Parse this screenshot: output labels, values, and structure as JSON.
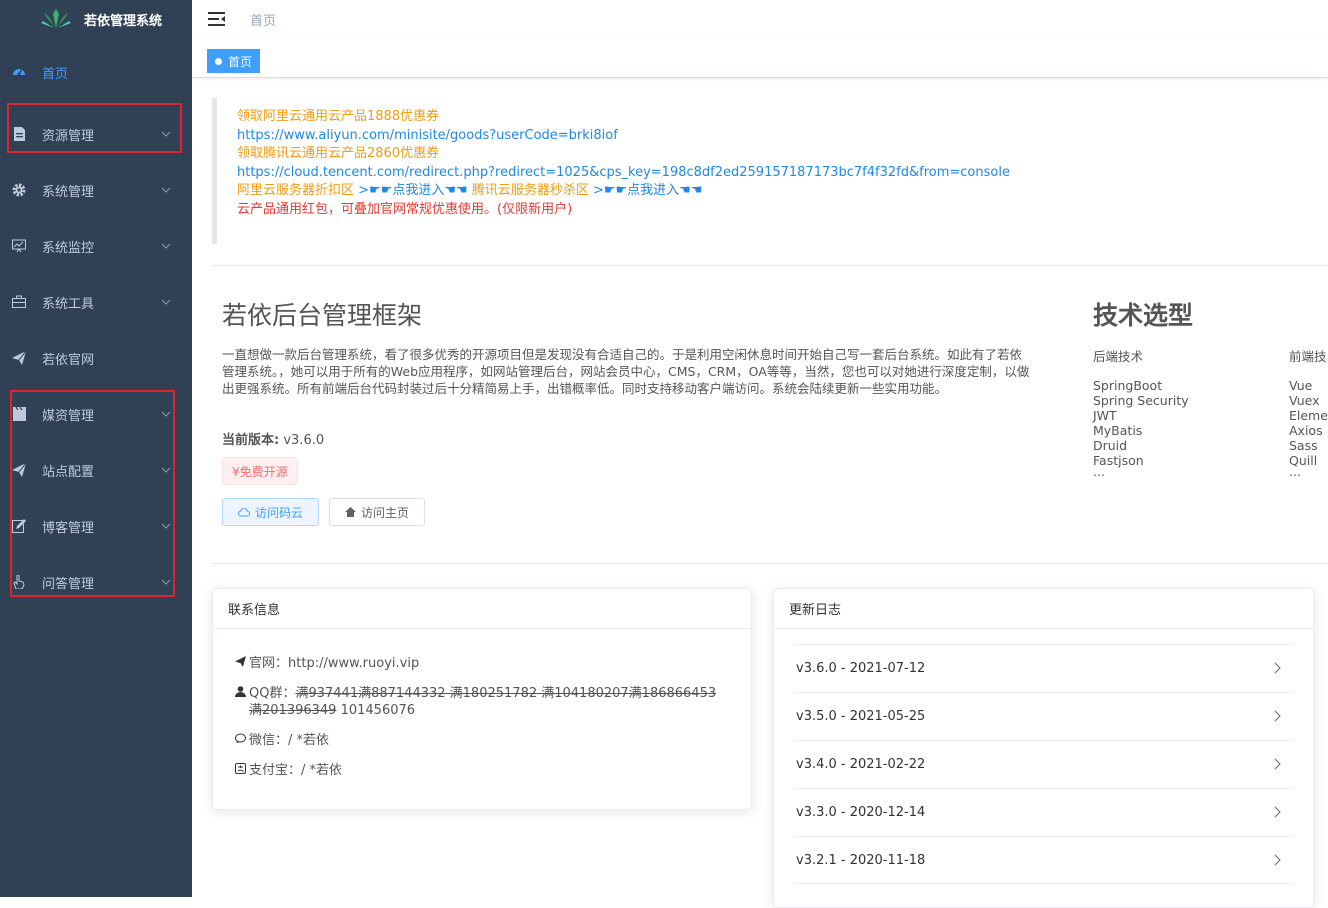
{
  "app": {
    "title": "若依管理系统"
  },
  "sidebar": {
    "items": [
      {
        "label": "首页",
        "icon": "dashboard-icon"
      },
      {
        "label": "资源管理",
        "icon": "document-icon"
      },
      {
        "label": "系统管理",
        "icon": "gear-icon"
      },
      {
        "label": "系统监控",
        "icon": "monitor-icon"
      },
      {
        "label": "系统工具",
        "icon": "toolbox-icon"
      },
      {
        "label": "若依官网",
        "icon": "paper-plane-icon"
      },
      {
        "label": "媒资管理",
        "icon": "clapper-icon"
      },
      {
        "label": "站点配置",
        "icon": "paper-plane-icon"
      },
      {
        "label": "博客管理",
        "icon": "edit-icon"
      },
      {
        "label": "问答管理",
        "icon": "hand-icon"
      }
    ]
  },
  "navbar": {
    "breadcrumb": "首页"
  },
  "tags": {
    "active": "首页"
  },
  "notice": {
    "line1": "领取阿里云通用云产品1888优惠券",
    "line2": "https://www.aliyun.com/minisite/goods?userCode=brki8iof",
    "line3": "领取腾讯云通用云产品2860优惠券",
    "line4": "https://cloud.tencent.com/redirect.php?redirect=1025&cps_key=198c8df2ed259157187173bc7f4f32fd&from=console",
    "line5a": "阿里云服务器折扣区",
    "line5b": ">☛☛点我进入☚☚",
    "line5c": "腾讯云服务器秒杀区",
    "line5d": ">☛☛点我进入☚☚",
    "line6": "云产品通用红包，可叠加官网常规优惠使用。(仅限新用户)"
  },
  "intro": {
    "title": "若依后台管理框架",
    "description": "一直想做一款后台管理系统，看了很多优秀的开源项目但是发现没有合适自己的。于是利用空闲休息时间开始自己写一套后台系统。如此有了若依管理系统。，她可以用于所有的Web应用程序，如网站管理后台，网站会员中心，CMS，CRM，OA等等，当然，您也可以对她进行深度定制，以做出更强系统。所有前端后台代码封装过后十分精简易上手，出错概率低。同时支持移动客户端访问。系统会陆续更新一些实用功能。",
    "version_label": "当前版本:",
    "version_value": "v3.6.0",
    "free_tag": "¥免费开源",
    "btn_gitee": "访问码云",
    "btn_home": "访问主页"
  },
  "tech": {
    "title": "技术选型",
    "backend_title": "后端技术",
    "backend": [
      "SpringBoot",
      "Spring Security",
      "JWT",
      "MyBatis",
      "Druid",
      "Fastjson",
      "..."
    ],
    "frontend_title": "前端技",
    "frontend": [
      "Vue",
      "Vuex",
      "Elemen",
      "Axios",
      "Sass",
      "Quill",
      "..."
    ]
  },
  "contact": {
    "header": "联系信息",
    "website_label": "官网：",
    "website_value": "http://www.ruoyi.vip",
    "qq_label": "QQ群：",
    "qq_struck": "满937441满887144332 满180251782 满104180207满186866453 满201396349",
    "qq_value": "101456076",
    "wechat_label": "微信：",
    "wechat_value": "/ *若依",
    "alipay_label": "支付宝：",
    "alipay_value": "/ *若依"
  },
  "changelog": {
    "header": "更新日志",
    "items": [
      "v3.6.0 - 2021-07-12",
      "v3.5.0 - 2021-05-25",
      "v3.4.0 - 2021-02-22",
      "v3.3.0 - 2020-12-14",
      "v3.2.1 - 2020-11-18"
    ]
  },
  "colors": {
    "sidebar_bg": "#304156",
    "accent": "#409eff",
    "highlight_box": "#e0232c"
  }
}
